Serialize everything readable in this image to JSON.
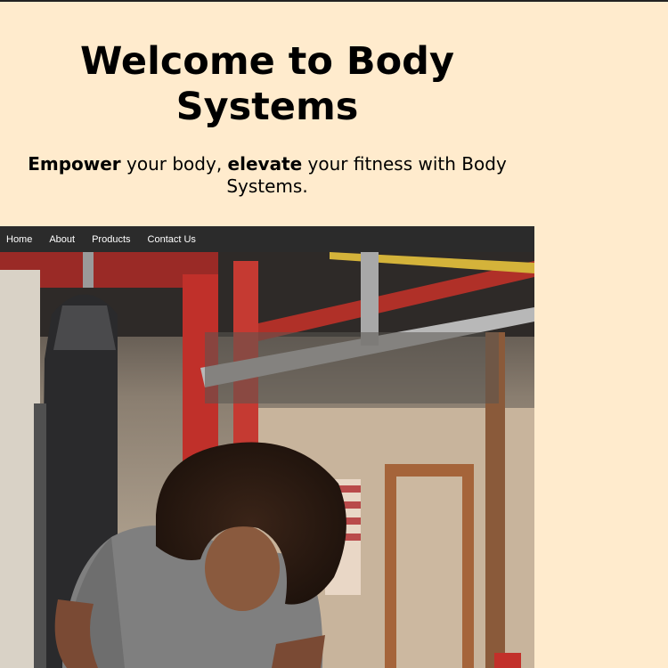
{
  "header": {
    "title_line1": "Welcome to Body",
    "title_line2": "Systems",
    "tagline": {
      "word1": "Empower",
      "part1": " your body, ",
      "word2": "elevate",
      "part2": " your fitness with Body Systems."
    }
  },
  "nav": {
    "items": [
      {
        "label": "Home"
      },
      {
        "label": "About"
      },
      {
        "label": "Products"
      },
      {
        "label": "Contact Us"
      }
    ]
  },
  "hero": {
    "image_subject": "woman-working-out-in-boxing-gym"
  },
  "colors": {
    "page_background": "#FFEBCD",
    "nav_background": "#2B2B2B",
    "nav_text": "#FFFFFF"
  }
}
